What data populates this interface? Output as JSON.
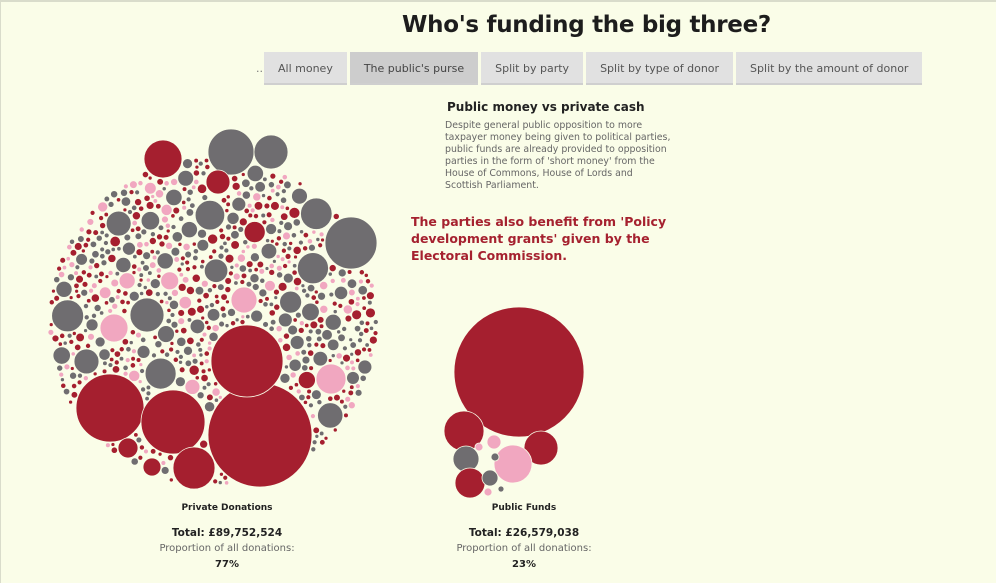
{
  "title": "Who's funding the big three?",
  "tabs": {
    "ellipsis": "..",
    "items": [
      "All money",
      "The public's purse",
      "Split by party",
      "Split by type of donor",
      "Split by the amount of donor"
    ],
    "active_index": 1
  },
  "info": {
    "title": "Public money vs private cash",
    "body": "Despite general public opposition to more taxpayer money being given to political parties, public funds are already provided to opposition parties in the form of 'short money' from the House of Commons, House of Lords and Scottish Parliament.",
    "highlight": "The parties also benefit from 'Policy development grants' given by the Electoral Commission."
  },
  "colors": {
    "red": "#a51f2f",
    "grey": "#6f6d70",
    "pink": "#f1a7c0",
    "background": "#fafde8"
  },
  "chart_data": {
    "type": "bubble",
    "clusters": [
      {
        "name": "Private Donations",
        "total_label": "Total: £89,752,524",
        "proportion_label": "Proportion of all donations:",
        "proportion": "77%",
        "total": 89752524
      },
      {
        "name": "Public Funds",
        "total_label": "Total: £26,579,038",
        "proportion_label": "Proportion of all donations:",
        "proportion": "23%",
        "total": 26579038
      }
    ]
  }
}
